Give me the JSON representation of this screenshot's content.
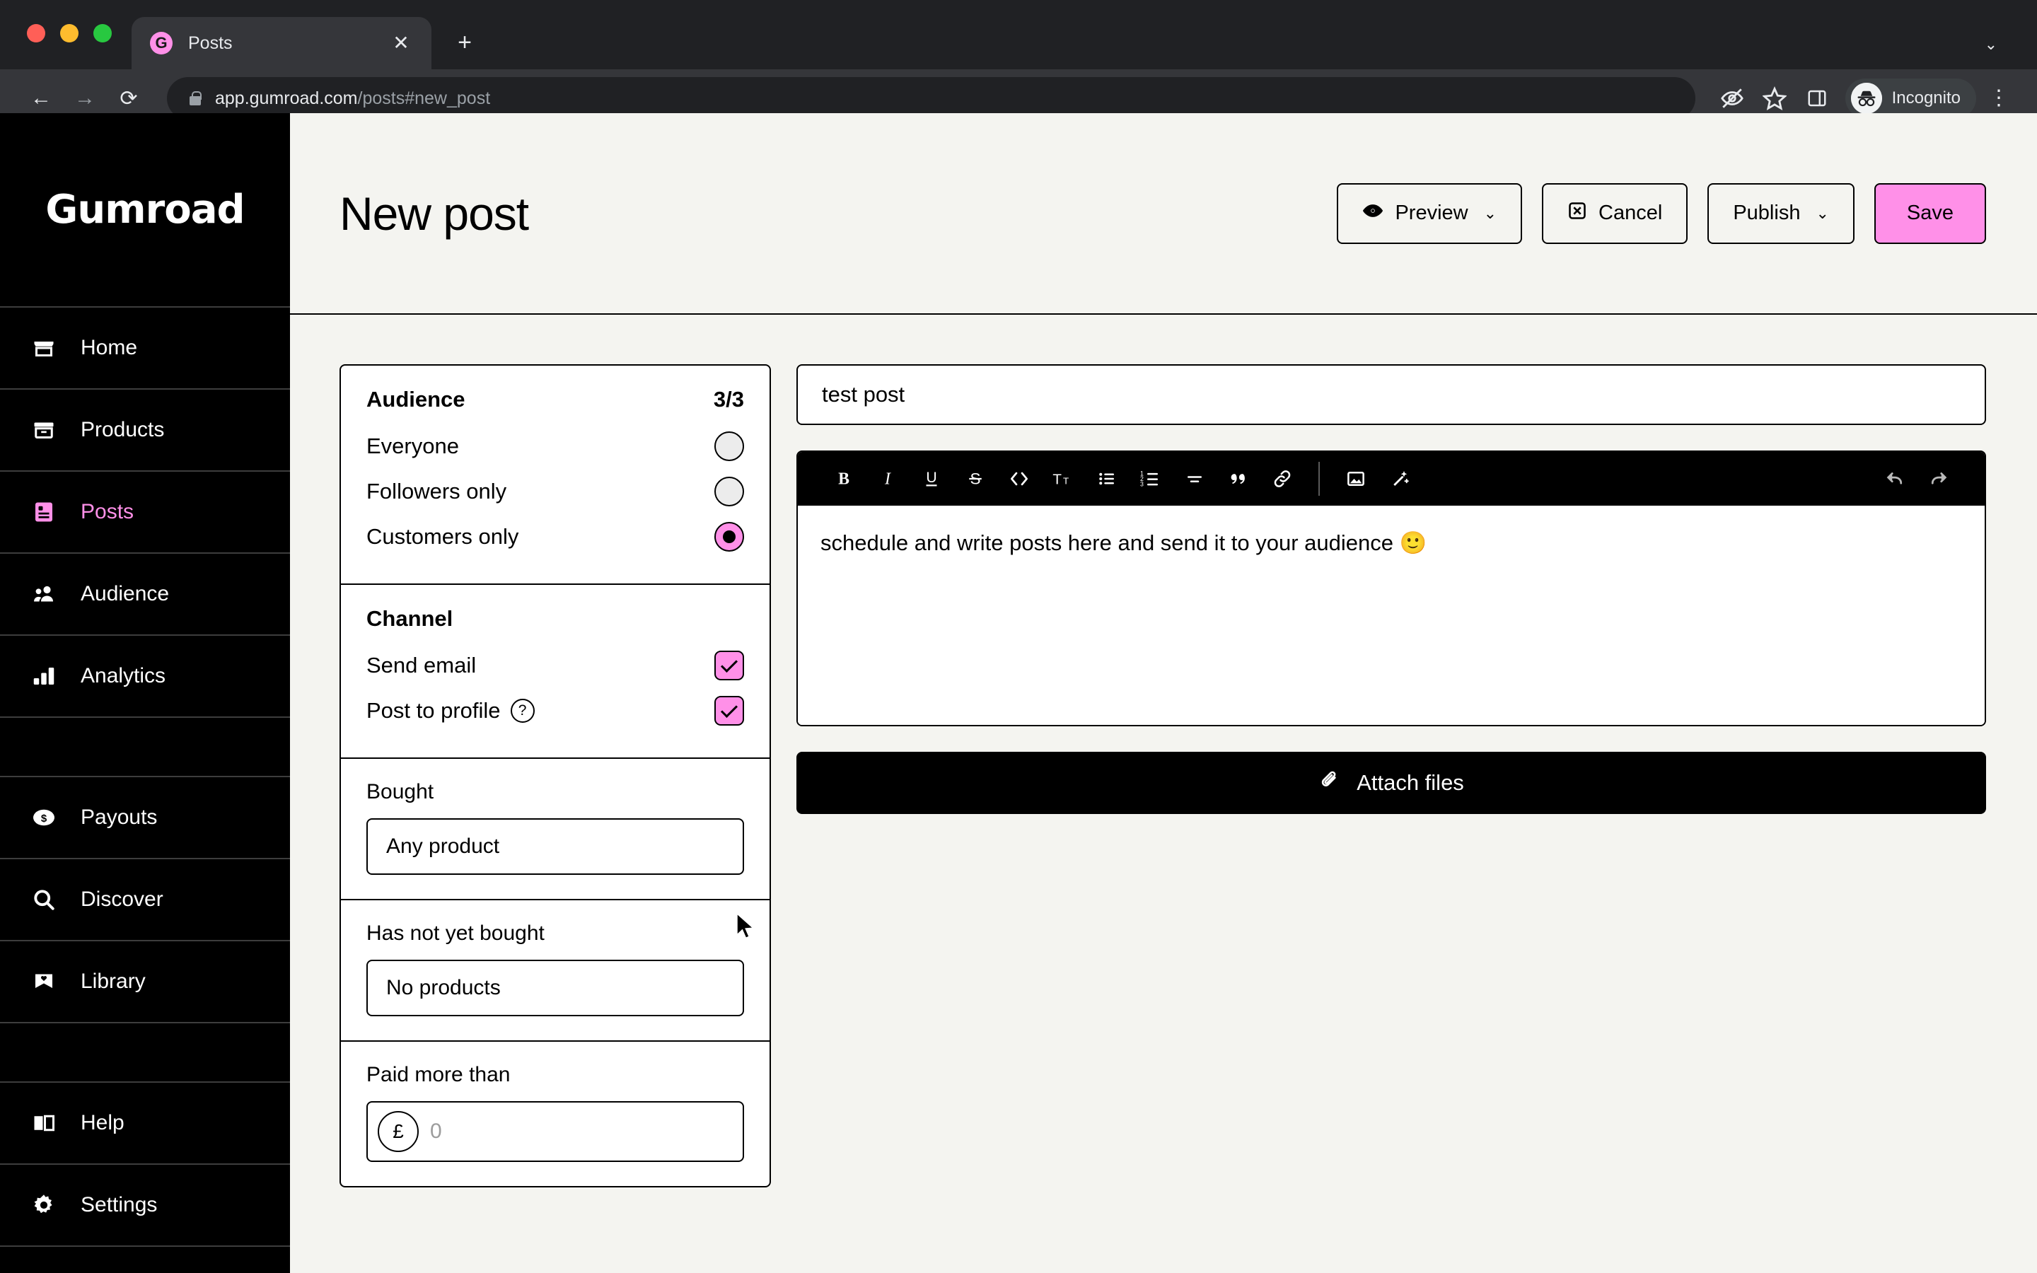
{
  "browser": {
    "tab": {
      "title": "Posts",
      "favicon_letter": "G",
      "favicon_color": "#ff90e8",
      "close_icon": "close-icon"
    },
    "new_tab_icon": "plus-icon",
    "tablist_chevron": "chevron-down-icon",
    "nav": {
      "back_icon": "back-arrow-icon",
      "forward_icon": "forward-arrow-icon",
      "reload_icon": "reload-icon"
    },
    "omnibox": {
      "lock_icon": "lock-icon",
      "url_domain": "app.gumroad.com",
      "url_path": "/posts#new_post"
    },
    "toolbar_icons": [
      "eye-slash-icon",
      "star-icon",
      "side-panel-icon"
    ],
    "profile": {
      "label": "Incognito",
      "icon": "incognito-icon"
    },
    "menu_icon": "kebab-menu-icon"
  },
  "sidebar": {
    "logo": "Gumroad",
    "items": [
      {
        "label": "Home",
        "icon": "storefront-icon",
        "active": false
      },
      {
        "label": "Products",
        "icon": "archive-box-icon",
        "active": false
      },
      {
        "label": "Posts",
        "icon": "document-icon",
        "active": true
      },
      {
        "label": "Audience",
        "icon": "people-icon",
        "active": false
      },
      {
        "label": "Analytics",
        "icon": "bar-chart-icon",
        "active": false
      },
      {
        "label": "",
        "icon": "",
        "active": false
      },
      {
        "label": "Payouts",
        "icon": "dollar-coin-icon",
        "active": false
      },
      {
        "label": "Discover",
        "icon": "search-icon",
        "active": false
      },
      {
        "label": "Library",
        "icon": "bookmark-heart-icon",
        "active": false
      },
      {
        "label": "",
        "icon": "",
        "active": false
      },
      {
        "label": "Help",
        "icon": "open-book-icon",
        "active": false
      },
      {
        "label": "Settings",
        "icon": "gear-icon",
        "active": false
      }
    ]
  },
  "header": {
    "title": "New post",
    "buttons": {
      "preview": {
        "label": "Preview",
        "icon": "eye-icon",
        "chevron": "chevron-down-icon"
      },
      "cancel": {
        "label": "Cancel",
        "icon": "close-box-icon"
      },
      "publish": {
        "label": "Publish",
        "chevron": "chevron-down-icon"
      },
      "save": {
        "label": "Save",
        "color": "#ff90e8"
      }
    }
  },
  "audience_panel": {
    "title": "Audience",
    "count": "3/3",
    "options": [
      {
        "label": "Everyone",
        "selected": false
      },
      {
        "label": "Followers only",
        "selected": false
      },
      {
        "label": "Customers only",
        "selected": true
      }
    ]
  },
  "channel_panel": {
    "title": "Channel",
    "options": [
      {
        "label": "Send email",
        "checked": true,
        "help": false
      },
      {
        "label": "Post to profile",
        "checked": true,
        "help": true,
        "help_icon": "question-mark-icon"
      }
    ]
  },
  "filters": {
    "bought": {
      "label": "Bought",
      "value": "Any product"
    },
    "not_bought": {
      "label": "Has not yet bought",
      "value": "No products"
    },
    "paid_more_than": {
      "label": "Paid more than",
      "currency": "£",
      "placeholder": "0",
      "value": ""
    }
  },
  "editor": {
    "post_title": "test post",
    "post_title_placeholder": "Title",
    "body": "schedule and write posts here and send it to your audience 🙂",
    "toolbar": [
      {
        "name": "bold-icon",
        "glyph": "B"
      },
      {
        "name": "italic-icon",
        "glyph": "I"
      },
      {
        "name": "underline-icon",
        "glyph": "U"
      },
      {
        "name": "strikethrough-icon",
        "glyph": "S"
      },
      {
        "name": "code-icon",
        "glyph": "<>"
      },
      {
        "name": "text-size-icon",
        "glyph": "Tт"
      },
      {
        "name": "bullet-list-icon",
        "glyph": ""
      },
      {
        "name": "numbered-list-icon",
        "glyph": ""
      },
      {
        "name": "horizontal-rule-icon",
        "glyph": ""
      },
      {
        "name": "blockquote-icon",
        "glyph": "“"
      },
      {
        "name": "link-icon",
        "glyph": ""
      },
      {
        "name": "image-icon",
        "glyph": ""
      },
      {
        "name": "magic-wand-icon",
        "glyph": ""
      }
    ],
    "undo_icon": "undo-arrow-icon",
    "redo_icon": "redo-arrow-icon",
    "attach_button": {
      "label": "Attach files",
      "icon": "paperclip-icon"
    }
  },
  "colors": {
    "brand_pink": "#ff90e8",
    "page_bg": "#f4f4f0",
    "ink": "#000000"
  }
}
